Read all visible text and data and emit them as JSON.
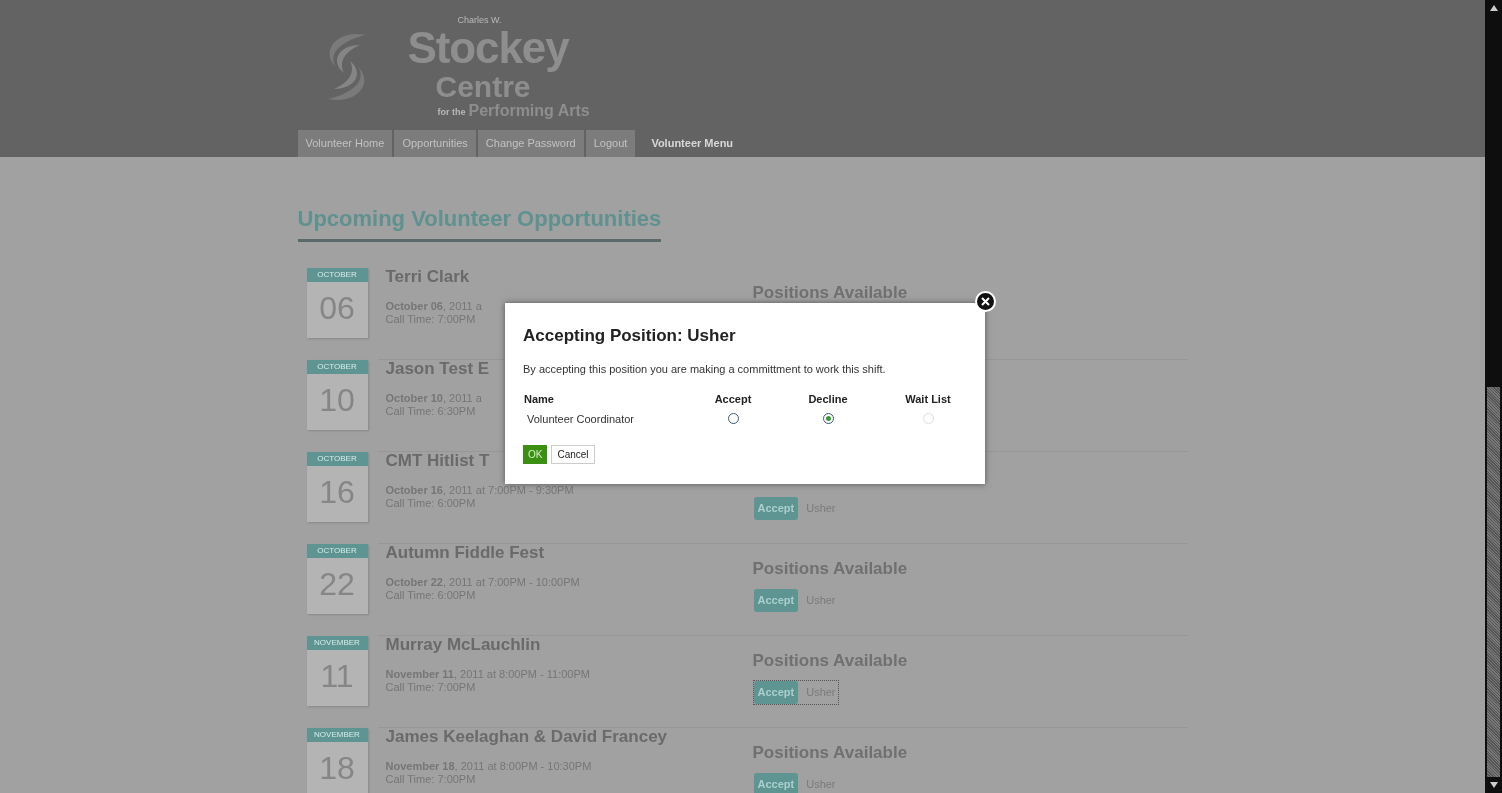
{
  "header": {
    "logo": {
      "overline": "Charles W.",
      "name": "Stockey",
      "name_line2": "Centre",
      "prefix": "for the",
      "tagline": "Performing Arts"
    },
    "nav": [
      {
        "label": "Volunteer Home"
      },
      {
        "label": "Opportunities"
      },
      {
        "label": "Change Password"
      },
      {
        "label": "Logout"
      }
    ],
    "menu_title": "Volunteer Menu"
  },
  "page_title": "Upcoming Volunteer Opportunities",
  "events": [
    {
      "month": "OCTOBER",
      "day": "06",
      "title": "Terri Clark",
      "date": "**October 06**, 2011 a",
      "call_time": "Call Time: 7:00PM",
      "positions_title": "Positions Available"
    },
    {
      "month": "OCTOBER",
      "day": "10",
      "title": "Jason Test E",
      "date": "**October 10**, 2011 a",
      "call_time": "Call Time: 6:30PM"
    },
    {
      "month": "OCTOBER",
      "day": "16",
      "title": "CMT Hitlist T",
      "date": "**October 16**, 2011 at 7:00PM - 9:30PM",
      "call_time": "Call Time: 6:00PM",
      "positions": [
        {
          "action": "Accept",
          "name": "Usher",
          "focused": false
        }
      ]
    },
    {
      "month": "OCTOBER",
      "day": "22",
      "title": "Autumn Fiddle Fest",
      "date": "**October 22**, 2011 at 7:00PM - 10:00PM",
      "call_time": "Call Time: 6:00PM",
      "positions_title": "Positions Available",
      "positions": [
        {
          "action": "Accept",
          "name": "Usher",
          "focused": false
        }
      ]
    },
    {
      "month": "NOVEMBER",
      "day": "11",
      "title": "Murray McLauchlin",
      "date": "**November 11**, 2011 at 8:00PM - 11:00PM",
      "call_time": "Call Time: 7:00PM",
      "positions_title": "Positions Available",
      "positions": [
        {
          "action": "Accept",
          "name": "Usher",
          "focused": true
        }
      ]
    },
    {
      "month": "NOVEMBER",
      "day": "18",
      "title": "James Keelaghan & David Francey",
      "date": "**November 18**, 2011 at 8:00PM - 10:30PM",
      "call_time": "Call Time: 7:00PM",
      "positions_title": "Positions Available",
      "positions": [
        {
          "action": "Accept",
          "name": "Usher",
          "focused": false
        }
      ]
    }
  ],
  "modal": {
    "title": "Accepting Position: Usher",
    "message": "By accepting this position you are making a committment to work this shift.",
    "columns": [
      "Name",
      "Accept",
      "Decline",
      "Wait List"
    ],
    "rows": [
      {
        "name": "Volunteer Coordinator",
        "options": [
          {
            "selected": false,
            "disabled": false
          },
          {
            "selected": true,
            "disabled": false
          },
          {
            "selected": false,
            "disabled": true
          }
        ]
      }
    ],
    "buttons": [
      {
        "label": "OK",
        "kind": "primary"
      },
      {
        "label": "Cancel",
        "kind": "secondary"
      }
    ]
  }
}
